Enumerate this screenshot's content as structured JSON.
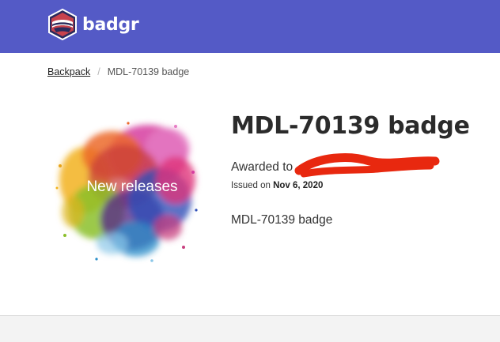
{
  "header": {
    "brand_name": "badgr",
    "logo_icon": "badgr-badger-logo-icon",
    "background_color": "#545ac6"
  },
  "breadcrumb": {
    "link_label": "Backpack",
    "separator": "/",
    "current": "MDL-70139 badge"
  },
  "badge": {
    "image_text": "New releases",
    "title": "MDL-70139 badge",
    "awarded_prefix": "Awarded to",
    "awarded_name_redacted": true,
    "issued_prefix": "Issued on",
    "issued_date": "Nov 6, 2020",
    "description": "MDL-70139 badge"
  },
  "colors": {
    "redaction": "#e8280f",
    "title_text": "#2b2b2b",
    "footer_background": "#f3f3f3"
  }
}
